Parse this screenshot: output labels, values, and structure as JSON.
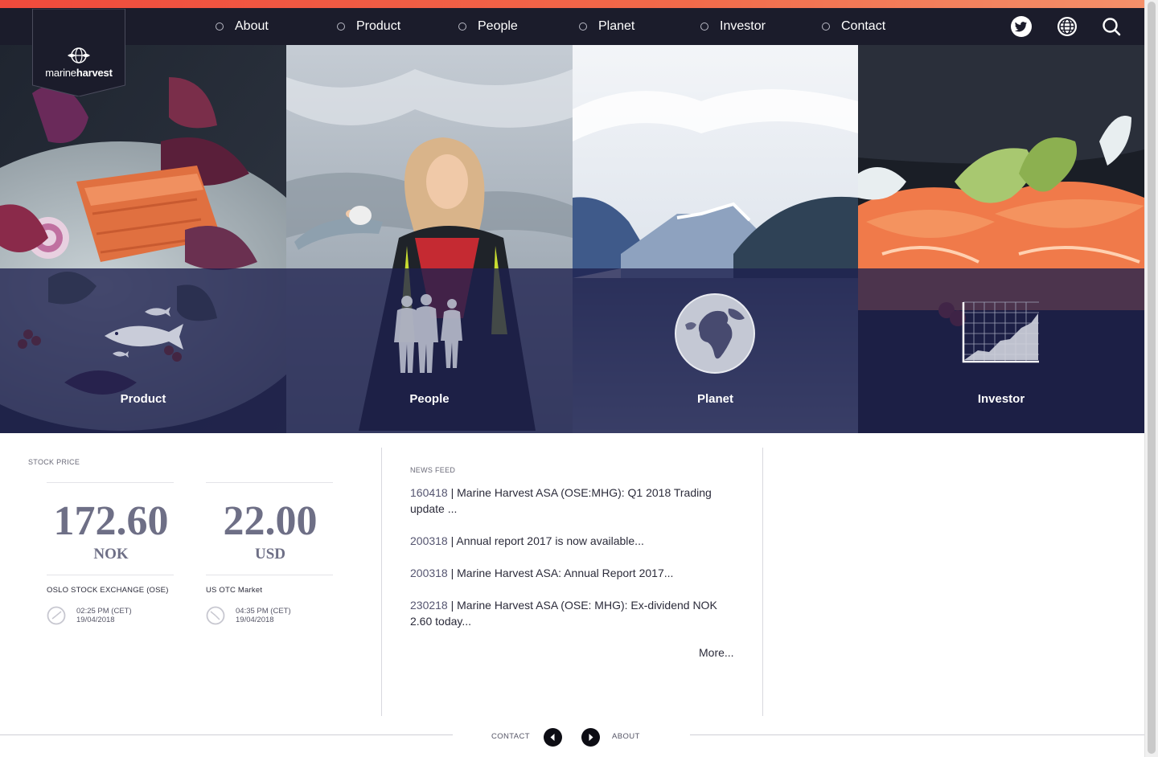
{
  "brand": {
    "name_light": "marine",
    "name_bold": "harvest"
  },
  "nav": {
    "items": [
      {
        "label": "About"
      },
      {
        "label": "Product"
      },
      {
        "label": "People"
      },
      {
        "label": "Planet"
      },
      {
        "label": "Investor"
      },
      {
        "label": "Contact"
      }
    ],
    "icons": [
      "twitter-icon",
      "globe-icon",
      "search-icon"
    ]
  },
  "tiles": [
    {
      "label": "Product",
      "icon": "fish-icon"
    },
    {
      "label": "People",
      "icon": "people-silhouette-icon"
    },
    {
      "label": "Planet",
      "icon": "earth-icon"
    },
    {
      "label": "Investor",
      "icon": "growth-chart-icon"
    }
  ],
  "stock": {
    "title": "STOCK PRICE",
    "quotes": [
      {
        "value": "172.60",
        "currency": "NOK",
        "exchange": "OSLO STOCK EXCHANGE (OSE)",
        "time": "02:25 PM (CET)",
        "date": "19/04/2018"
      },
      {
        "value": "22.00",
        "currency": "USD",
        "exchange": "US OTC Market",
        "time": "04:35 PM (CET)",
        "date": "19/04/2018"
      }
    ]
  },
  "news": {
    "title": "NEWS FEED",
    "items": [
      {
        "code": "160418",
        "text": " | Marine Harvest ASA (OSE:MHG): Q1 2018 Trading update ..."
      },
      {
        "code": "200318",
        "text": " | Annual report 2017 is now available..."
      },
      {
        "code": "200318",
        "text": " | Marine Harvest ASA: Annual Report 2017..."
      },
      {
        "code": "230218",
        "text": " | Marine Harvest ASA (OSE: MHG): Ex-dividend NOK 2.60 today..."
      }
    ],
    "more": "More..."
  },
  "footer": {
    "prev_label": "CONTACT",
    "next_label": "ABOUT"
  },
  "colors": {
    "accent": "#f04a3c",
    "navbar": "#1b1c2b",
    "overlay": "#1e204e",
    "stock_text": "#6e6f86"
  }
}
